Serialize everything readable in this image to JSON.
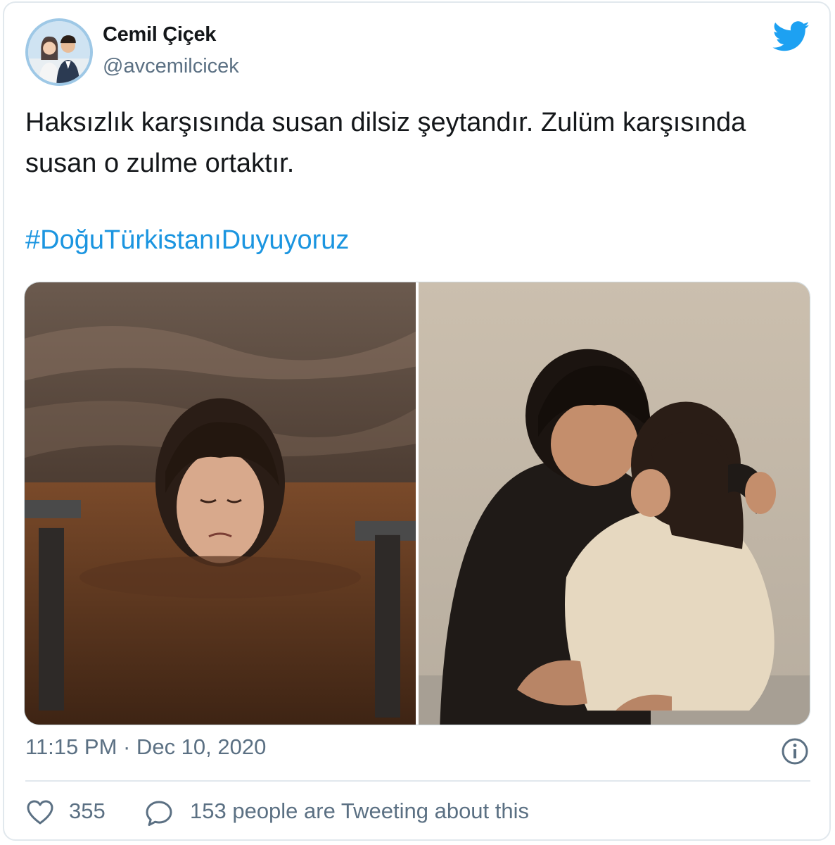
{
  "tweet": {
    "author_name": "Cemil Çiçek",
    "author_handle": "@avcemilcicek",
    "text": "Haksızlık karşısında susan dilsiz şeytandır. Zulüm karşısında\nsusan o zulme ortaktır.",
    "hashtag": "#DoğuTürkistanıDuyuyoruz",
    "timestamp": "11:15 PM · Dec 10, 2020",
    "like_count": "355",
    "discussion_text": "153 people are Tweeting about this"
  },
  "icons": {
    "brand": "twitter-bird-icon",
    "info": "info-icon",
    "like": "heart-icon",
    "reply": "speech-bubble-icon"
  },
  "colors": {
    "brand": "#1da1f2",
    "hashtag": "#1b95e0",
    "secondary_text": "#5b7083",
    "border": "#e1e8ed"
  }
}
